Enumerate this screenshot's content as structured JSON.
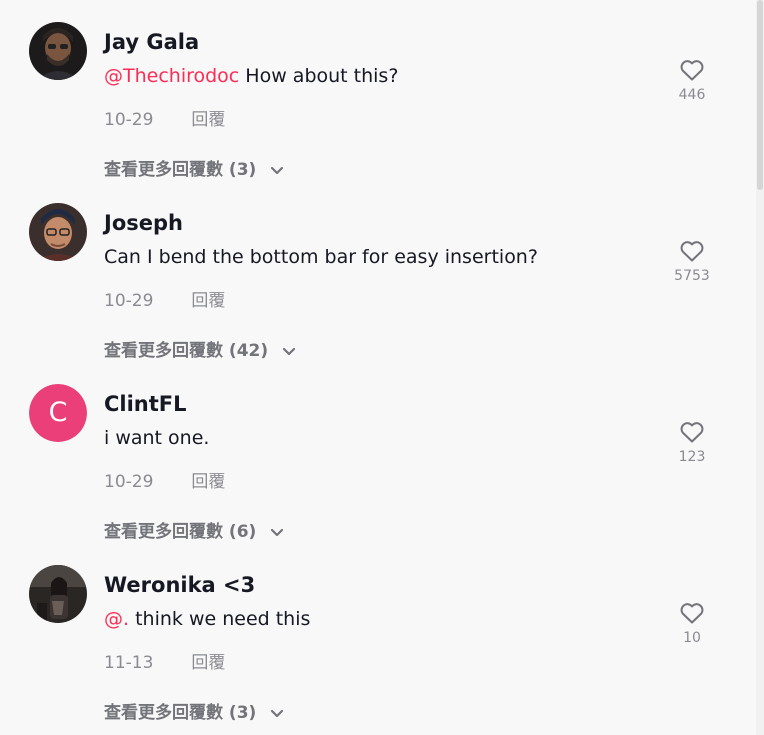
{
  "labels": {
    "reply": "回覆",
    "view_more_replies": "查看更多回覆數"
  },
  "colors": {
    "mention": "#fe2c55",
    "avatar_letter_bg": "#ea3f79"
  },
  "comments": [
    {
      "username": "Jay Gala",
      "mention": "@Thechirodoc",
      "text": " How about this?",
      "date": "10-29",
      "likes": "446",
      "reply_count": "(3)",
      "avatar": "photo"
    },
    {
      "username": "Joseph",
      "mention": "",
      "text": "Can I bend the bottom bar for easy insertion?",
      "date": "10-29",
      "likes": "5753",
      "reply_count": "(42)",
      "avatar": "photo"
    },
    {
      "username": "ClintFL",
      "mention": "",
      "text": "i want one.",
      "date": "10-29",
      "likes": "123",
      "reply_count": "(6)",
      "avatar": "letter",
      "avatar_letter": "C"
    },
    {
      "username": "Weronika <3",
      "mention": "@.",
      "text": " think we need this",
      "date": "11-13",
      "likes": "10",
      "reply_count": "(3)",
      "avatar": "photo"
    }
  ]
}
